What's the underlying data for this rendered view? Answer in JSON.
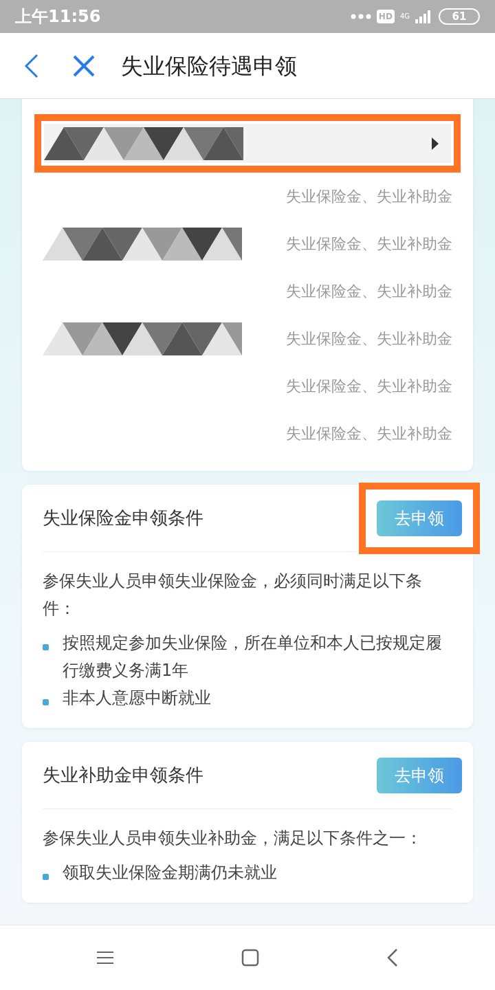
{
  "status_bar": {
    "time": "上午11:56",
    "hd": "HD",
    "network": "4G",
    "battery": "61"
  },
  "header": {
    "title": "失业保险待遇申领"
  },
  "benefits_card": {
    "selector": {
      "highlighted": true,
      "redacted": true
    },
    "rows": [
      {
        "value": "失业保险金、失业补助金",
        "redacted": false
      },
      {
        "value": "失业保险金、失业补助金",
        "redacted": true
      },
      {
        "value": "失业保险金、失业补助金",
        "redacted": false
      },
      {
        "value": "失业保险金、失业补助金",
        "redacted": true
      },
      {
        "value": "失业保险金、失业补助金",
        "redacted": false
      },
      {
        "value": "失业保险金、失业补助金",
        "redacted": false
      }
    ]
  },
  "sections": [
    {
      "title": "失业保险金申领条件",
      "button": "去申领",
      "highlighted": true,
      "intro": "参保失业人员申领失业保险金，必须同时满足以下条件：",
      "bullets": [
        "按照规定参加失业保险，所在单位和本人已按规定履行缴费义务满1年",
        "非本人意愿中断就业"
      ]
    },
    {
      "title": "失业补助金申领条件",
      "button": "去申领",
      "highlighted": false,
      "intro": "参保失业人员申领失业补助金，满足以下条件之一：",
      "bullets": [
        "领取失业保险金期满仍未就业"
      ]
    }
  ]
}
